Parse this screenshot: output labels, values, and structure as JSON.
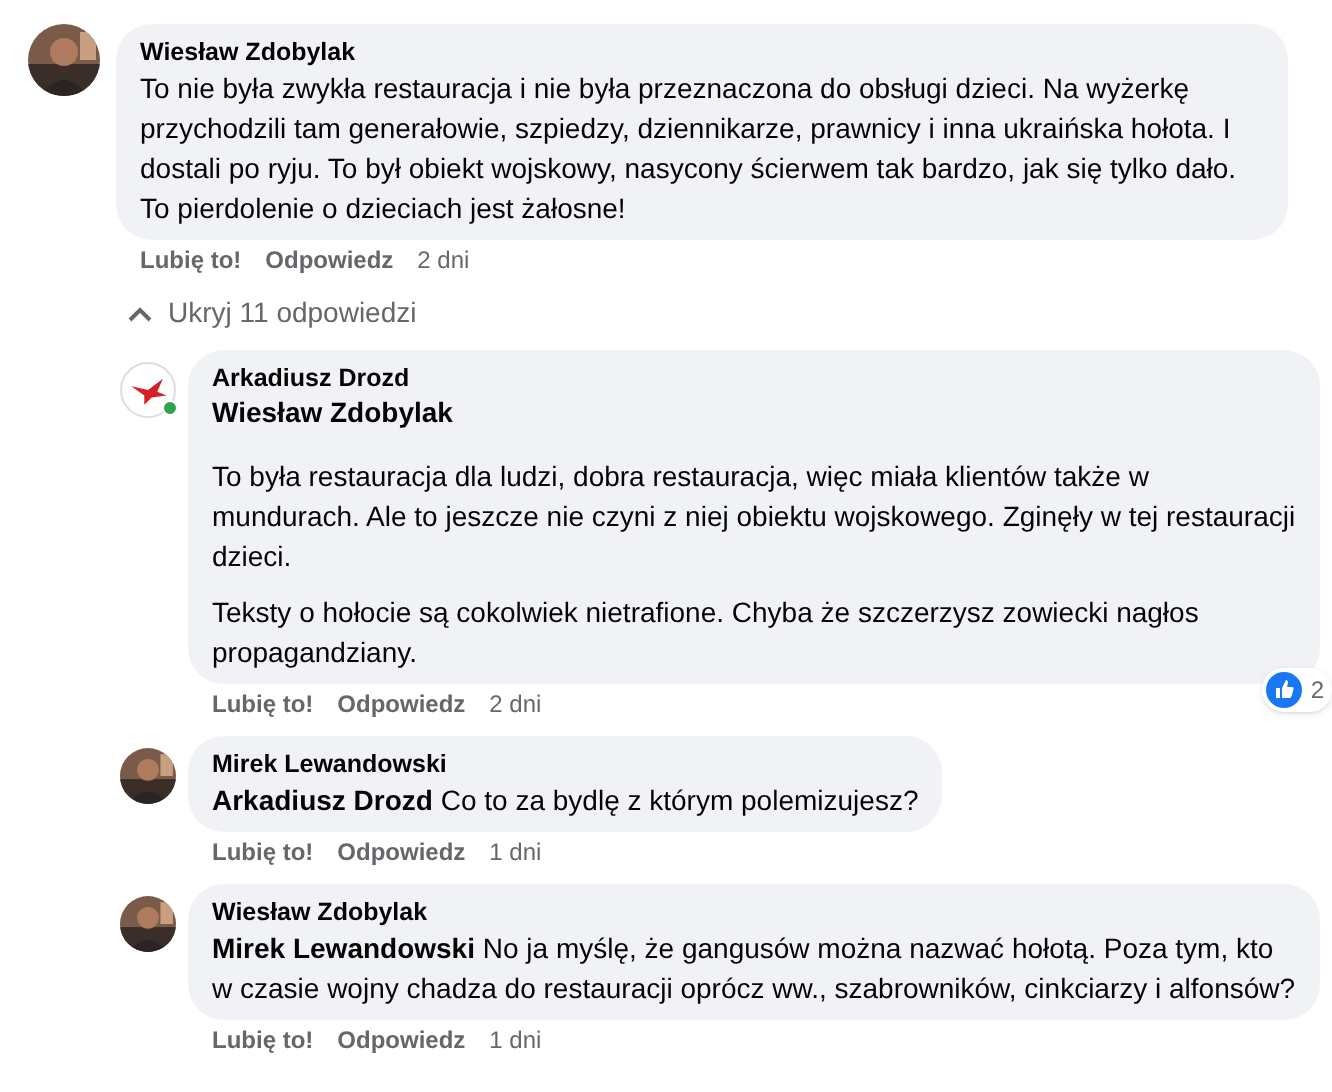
{
  "comment": {
    "author": "Wiesław Zdobylak",
    "online": false,
    "paragraphs": [
      "To nie była zwykła restauracja i nie była przeznaczona do obsługi dzieci. Na wyżerkę przychodzili tam generałowie, szpiedzy, dziennikarze, prawnicy i inna ukraińska hołota. I dostali po ryju. To był obiekt wojskowy, nasycony ścierwem tak bardzo, jak się tylko dało. To pierdolenie o dzieciach jest żałosne!"
    ],
    "actions": {
      "like": "Lubię to!",
      "reply": "Odpowiedz",
      "time": "2 dni"
    }
  },
  "replies_toggle": {
    "label": "Ukryj 11 odpowiedzi",
    "expanded": true
  },
  "replies": [
    {
      "author": "Arkadiusz Drozd",
      "kind": "bird",
      "online": true,
      "mention": "Wiesław Zdobylak",
      "paragraphs": [
        "To była restauracja dla ludzi, dobra restauracja, więc miała klientów także w mundurach. Ale to jeszcze nie czyni z niej obiektu wojskowego. Zginęły w tej restauracji dzieci.",
        "Teksty o hołocie są cokolwiek nietrafione. Chyba że szczerzysz zowiecki nagłos propagandziany."
      ],
      "reactions": "2",
      "actions": {
        "like": "Lubię to!",
        "reply": "Odpowiedz",
        "time": "2 dni"
      }
    },
    {
      "author": "Mirek Lewandowski",
      "online": false,
      "paragraphs": [
        "**Arkadiusz Drozd** Co to za bydlę z którym polemizujesz?"
      ],
      "actions": {
        "like": "Lubię to!",
        "reply": "Odpowiedz",
        "time": "1 dni"
      }
    },
    {
      "author": "Wiesław Zdobylak",
      "online": false,
      "paragraphs": [
        "**Mirek Lewandowski** No ja myślę, że gangusów można nazwać hołotą. Poza tym, kto w czasie wojny chadza do restauracji oprócz ww., szabrowników, cinkciarzy i alfonsów?"
      ],
      "actions": {
        "like": "Lubię to!",
        "reply": "Odpowiedz",
        "time": "1 dni"
      }
    }
  ]
}
